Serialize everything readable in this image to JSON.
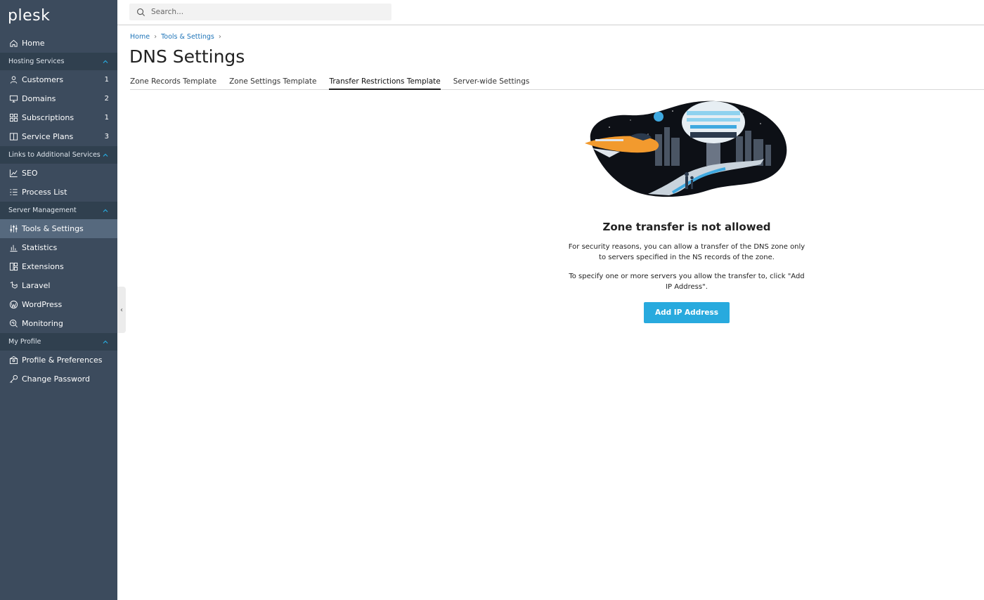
{
  "brand": {
    "name": "plesk"
  },
  "sidebar": {
    "items_top": [
      {
        "label": "Home",
        "icon": "home-icon"
      }
    ],
    "sections": [
      {
        "label": "Hosting Services",
        "items": [
          {
            "label": "Customers",
            "count": "1",
            "icon": "user-icon"
          },
          {
            "label": "Domains",
            "count": "2",
            "icon": "monitor-icon"
          },
          {
            "label": "Subscriptions",
            "count": "1",
            "icon": "grid-icon"
          },
          {
            "label": "Service Plans",
            "count": "3",
            "icon": "book-icon"
          }
        ]
      },
      {
        "label": "Links to Additional Services",
        "items": [
          {
            "label": "SEO",
            "icon": "chart-line-icon"
          },
          {
            "label": "Process List",
            "icon": "list-icon"
          }
        ]
      },
      {
        "label": "Server Management",
        "items": [
          {
            "label": "Tools & Settings",
            "icon": "sliders-icon",
            "active": true
          },
          {
            "label": "Statistics",
            "icon": "bar-chart-icon"
          },
          {
            "label": "Extensions",
            "icon": "extensions-icon"
          },
          {
            "label": "Laravel",
            "icon": "laravel-icon"
          },
          {
            "label": "WordPress",
            "icon": "wordpress-icon"
          },
          {
            "label": "Monitoring",
            "icon": "monitoring-icon"
          }
        ]
      },
      {
        "label": "My Profile",
        "items": [
          {
            "label": "Profile & Preferences",
            "icon": "profile-icon"
          },
          {
            "label": "Change Password",
            "icon": "key-icon"
          }
        ]
      }
    ]
  },
  "search": {
    "placeholder": "Search..."
  },
  "breadcrumb": [
    "Home",
    "Tools & Settings"
  ],
  "page": {
    "title": "DNS Settings"
  },
  "tabs": [
    {
      "label": "Zone Records Template"
    },
    {
      "label": "Zone Settings Template"
    },
    {
      "label": "Transfer Restrictions Template",
      "active": true
    },
    {
      "label": "Server-wide Settings"
    }
  ],
  "empty_state": {
    "title": "Zone transfer is not allowed",
    "text1": "For security reasons, you can allow a transfer of the DNS zone only to servers specified in the NS records of the zone.",
    "text2": "To specify one or more servers you allow the transfer to, click \"Add IP Address\".",
    "button_label": "Add IP Address"
  },
  "colors": {
    "sidebar_bg": "#3c4b5d",
    "section_bg": "#30404f",
    "active_bg": "#56697e",
    "link": "#1e74b8",
    "primary_button": "#28aade"
  }
}
